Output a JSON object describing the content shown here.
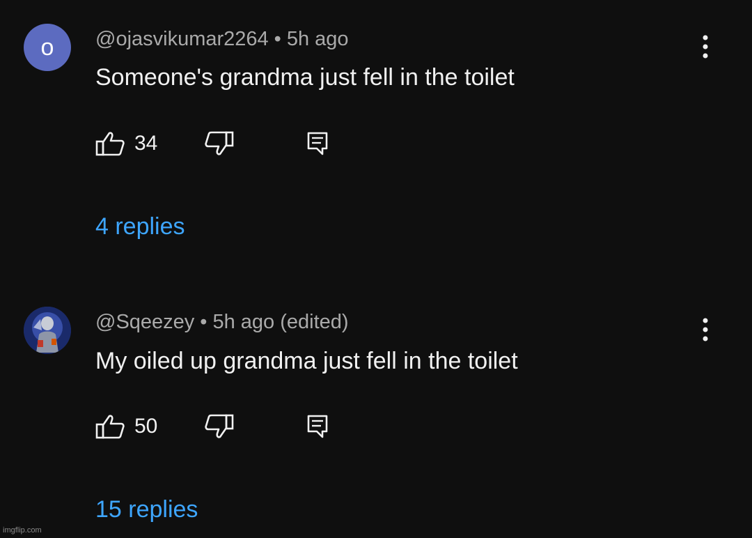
{
  "comments": [
    {
      "avatar_letter": "o",
      "author": "@ojasvikumar2264",
      "separator": "•",
      "time": "5h ago",
      "text": "Someone's grandma just fell in the toilet",
      "likes": "34",
      "replies": "4 replies"
    },
    {
      "author": "@Sqeezey",
      "separator": "•",
      "time": "5h ago (edited)",
      "text": "My oiled up grandma just fell in the toilet",
      "likes": "50",
      "replies": "15 replies"
    }
  ],
  "watermark": "imgflip.com",
  "colors": {
    "background": "#0f0f0f",
    "primary_text": "#f1f1f1",
    "secondary_text": "#aaaaaa",
    "link": "#3ea6ff",
    "avatar_bg": "#5c6bc0"
  },
  "icons": [
    "thumbs-up-icon",
    "thumbs-down-icon",
    "reply-icon",
    "more-vert-icon"
  ]
}
